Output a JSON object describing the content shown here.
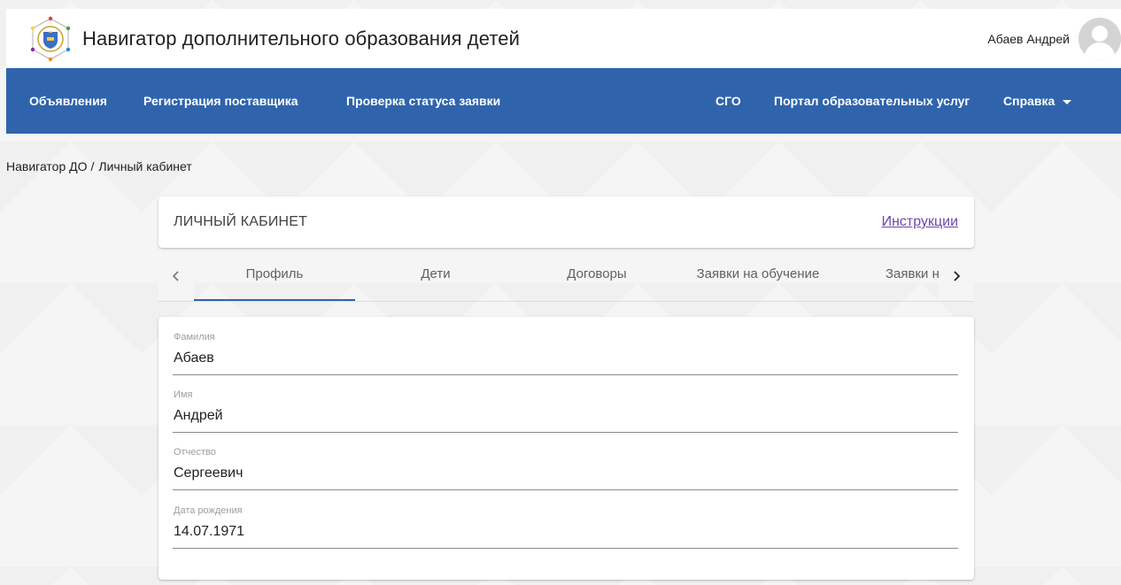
{
  "header": {
    "title": "Навигатор дополнительного образования детей",
    "user_name": "Абаев Андрей",
    "logo_icon": "regional-emblem-icon",
    "avatar_icon": "user-avatar-icon"
  },
  "nav": {
    "items": [
      {
        "label": "Объявления"
      },
      {
        "label": "Регистрация поставщика"
      },
      {
        "label": "Проверка статуса заявки"
      },
      {
        "label": "СГО"
      },
      {
        "label": "Портал образовательных услуг"
      },
      {
        "label": "Справка"
      }
    ],
    "color": "#2f64ad"
  },
  "breadcrumb": {
    "root": "Навигатор ДО",
    "separator": "/",
    "current": "Личный кабинет"
  },
  "cabinet": {
    "title": "ЛИЧНЫЙ КАБИНЕТ",
    "instructions_link": "Инструкции"
  },
  "tabs": {
    "items": [
      {
        "label": "Профиль",
        "active": true
      },
      {
        "label": "Дети",
        "active": false
      },
      {
        "label": "Договоры",
        "active": false
      },
      {
        "label": "Заявки на обучение",
        "active": false
      },
      {
        "label": "Заявки на",
        "active": false
      }
    ]
  },
  "profile": {
    "fields": [
      {
        "label": "Фамилия",
        "value": "Абаев"
      },
      {
        "label": "Имя",
        "value": "Андрей"
      },
      {
        "label": "Отчество",
        "value": "Сергеевич"
      },
      {
        "label": "Дата рождения",
        "value": "14.07.1971"
      }
    ]
  }
}
